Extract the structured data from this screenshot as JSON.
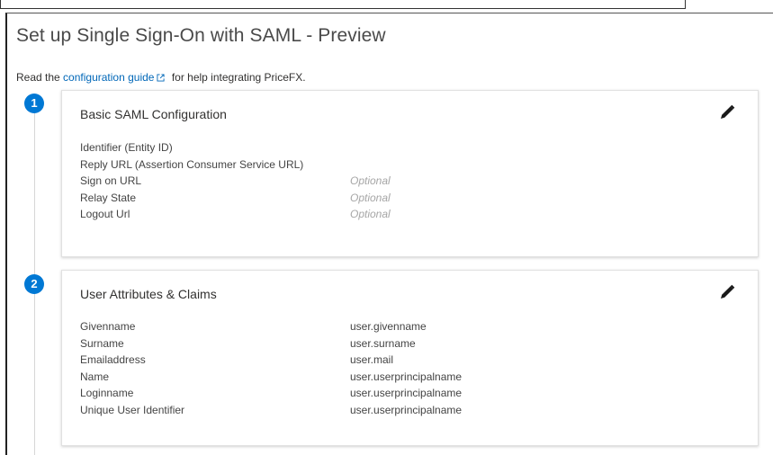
{
  "page": {
    "title": "Set up Single Sign-On with SAML - Preview",
    "intro_prefix": "Read the",
    "intro_link": "configuration guide",
    "intro_suffix": "for help integrating PriceFX."
  },
  "sections": [
    {
      "step": "1",
      "title": "Basic SAML Configuration",
      "rows": [
        {
          "label": "Identifier (Entity ID)",
          "value": ""
        },
        {
          "label": "Reply URL (Assertion Consumer Service URL)",
          "value": ""
        },
        {
          "label": "Sign on URL",
          "value": "Optional"
        },
        {
          "label": "Relay State",
          "value": "Optional"
        },
        {
          "label": "Logout Url",
          "value": "Optional"
        }
      ]
    },
    {
      "step": "2",
      "title": "User Attributes & Claims",
      "rows": [
        {
          "label": "Givenname",
          "value": "user.givenname"
        },
        {
          "label": "Surname",
          "value": "user.surname"
        },
        {
          "label": "Emailaddress",
          "value": "user.mail"
        },
        {
          "label": "Name",
          "value": "user.userprincipalname"
        },
        {
          "label": "Loginname",
          "value": "user.userprincipalname"
        },
        {
          "label": "Unique User Identifier",
          "value": "user.userprincipalname"
        }
      ]
    }
  ],
  "icons": {
    "edit": "pencil-icon",
    "external_link": "external-link-icon"
  },
  "colors": {
    "accent": "#0078d4",
    "link": "#0067b8",
    "optional_text": "#a6a6a6"
  }
}
